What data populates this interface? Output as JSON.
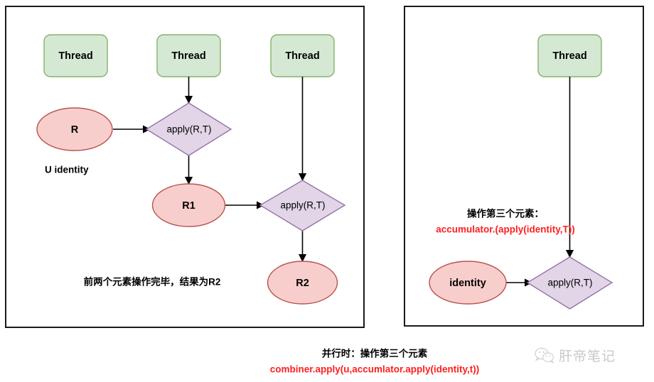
{
  "diagram": {
    "title": "Java Stream collect / reduce parallel accumulation diagram",
    "colors": {
      "thread_fill": "#d5e8d4",
      "thread_stroke": "#82b366",
      "ellipse_fill": "#f8cecc",
      "ellipse_stroke": "#b85450",
      "diamond_fill": "#e1d5e7",
      "diamond_stroke": "#9673a6",
      "edge": "#000000",
      "panel_border": "#1a1a1a",
      "highlight_red": "#ff2020"
    },
    "left_panel": {
      "threads": [
        {
          "label": "Thread"
        },
        {
          "label": "Thread"
        },
        {
          "label": "Thread"
        }
      ],
      "ellipses": [
        {
          "label": "R"
        },
        {
          "label": "R1"
        },
        {
          "label": "R2"
        }
      ],
      "diamonds": [
        {
          "label": "apply(R,T)"
        },
        {
          "label": "apply(R,T)"
        }
      ],
      "identity_note": "U identity",
      "caption": "前两个元素操作完毕，结果为R2"
    },
    "right_panel": {
      "threads": [
        {
          "label": "Thread"
        }
      ],
      "ellipses": [
        {
          "label": "identity"
        }
      ],
      "diamonds": [
        {
          "label": "apply(R,T)"
        }
      ],
      "note_title": "操作第三个元素：",
      "note_code": "accumulator.(apply(identity,T))"
    },
    "footer": {
      "line1": "并行时：操作第三个元素",
      "line2": "combiner.apply(u,accumlator.apply(identity,t))"
    },
    "watermark": {
      "icon": "wechat-icon",
      "label": "肝帝笔记"
    }
  }
}
